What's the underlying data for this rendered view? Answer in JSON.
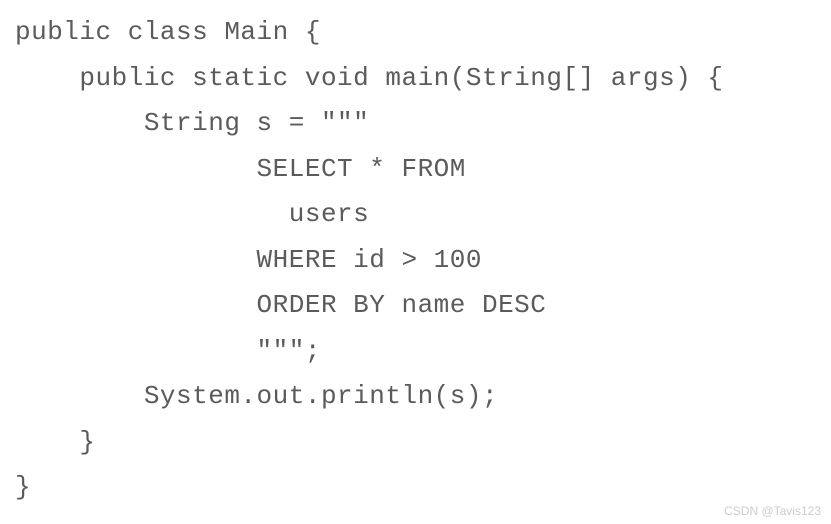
{
  "code": {
    "line1": "public class Main {",
    "line2": "    public static void main(String[] args) {",
    "line3": "        String s = \"\"\"",
    "line4": "               SELECT * FROM",
    "line5": "                 users",
    "line6": "               WHERE id > 100",
    "line7": "               ORDER BY name DESC",
    "line8": "               \"\"\";",
    "line9": "        System.out.println(s);",
    "line10": "    }",
    "line11": "}"
  },
  "watermark": "CSDN @Tavis123"
}
